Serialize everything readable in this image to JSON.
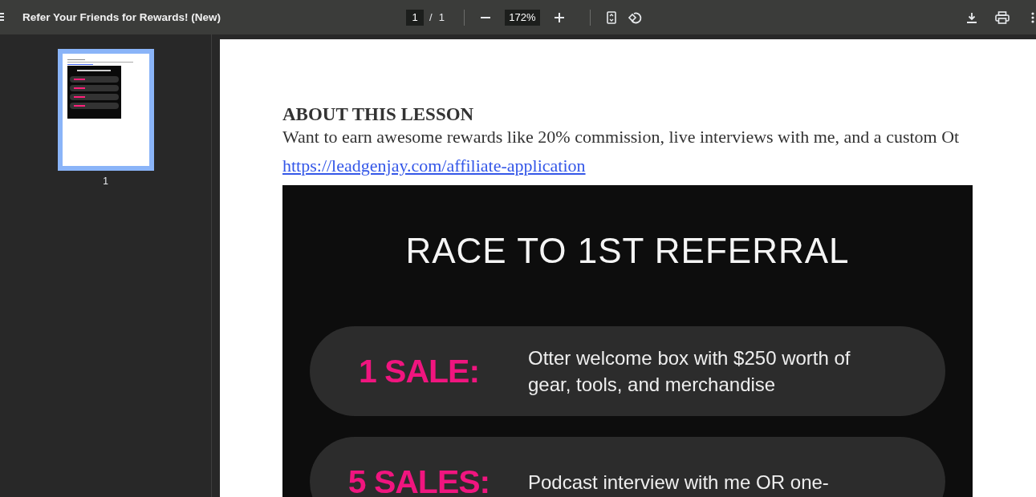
{
  "toolbar": {
    "title": "Refer Your Friends for Rewards! (New)",
    "page_input": "1",
    "page_separator": "/",
    "page_count": "1",
    "zoom": "172%"
  },
  "thumbnails": [
    {
      "label": "1",
      "selected": true
    }
  ],
  "document": {
    "heading": "ABOUT THIS LESSON",
    "paragraph": "Want to earn awesome rewards like 20% commission, live interviews with me, and a custom Ot",
    "link": "https://leadgenjay.com/affiliate-application",
    "banner": {
      "title": "RACE TO 1ST REFERRAL",
      "rewards": [
        {
          "tier": "1 SALE:",
          "description": [
            "Otter welcome box with $250 worth of",
            "gear, tools, and merchandise"
          ]
        },
        {
          "tier": "5 SALES:",
          "description": [
            "Podcast interview with me OR one-"
          ]
        }
      ]
    }
  }
}
